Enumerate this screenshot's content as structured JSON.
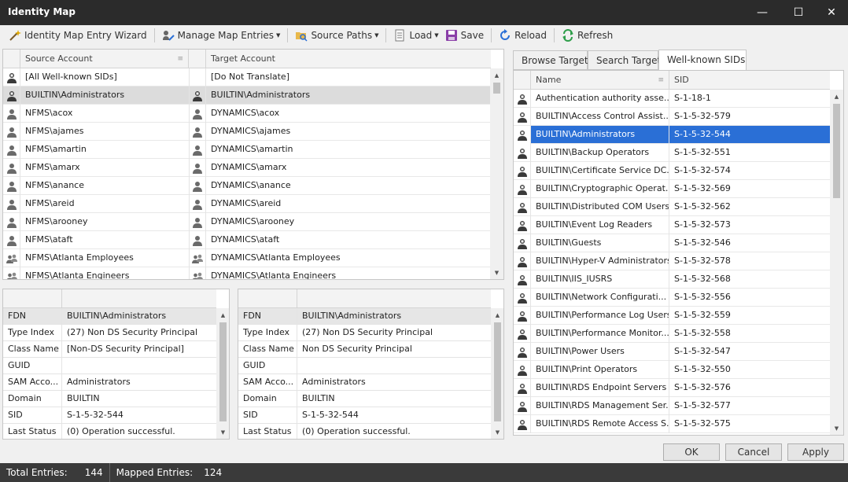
{
  "window": {
    "title": "Identity Map",
    "minimize": "—",
    "maximize": "☐",
    "close": "✕"
  },
  "toolbar": {
    "wizard": "Identity Map Entry Wizard",
    "manage": "Manage Map Entries",
    "source_paths": "Source Paths",
    "load": "Load",
    "save": "Save",
    "reload": "Reload",
    "refresh": "Refresh"
  },
  "map_grid": {
    "headers": {
      "source": "Source Account",
      "target": "Target Account"
    },
    "rows": [
      {
        "source": "[All Well-known SIDs]",
        "target": "[Do Not Translate]",
        "src_icon": "user-shield-icon",
        "tgt_icon": ""
      },
      {
        "source": "BUILTIN\\Administrators",
        "target": "BUILTIN\\Administrators",
        "src_icon": "user-shield-icon",
        "tgt_icon": "user-shield-icon"
      },
      {
        "source": "NFMS\\acox",
        "target": "DYNAMICS\\acox",
        "src_icon": "user-icon",
        "tgt_icon": "user-icon"
      },
      {
        "source": "NFMS\\ajames",
        "target": "DYNAMICS\\ajames",
        "src_icon": "user-icon",
        "tgt_icon": "user-icon"
      },
      {
        "source": "NFMS\\amartin",
        "target": "DYNAMICS\\amartin",
        "src_icon": "user-icon",
        "tgt_icon": "user-icon"
      },
      {
        "source": "NFMS\\amarx",
        "target": "DYNAMICS\\amarx",
        "src_icon": "user-icon",
        "tgt_icon": "user-icon"
      },
      {
        "source": "NFMS\\anance",
        "target": "DYNAMICS\\anance",
        "src_icon": "user-icon",
        "tgt_icon": "user-icon"
      },
      {
        "source": "NFMS\\areid",
        "target": "DYNAMICS\\areid",
        "src_icon": "user-icon",
        "tgt_icon": "user-icon"
      },
      {
        "source": "NFMS\\arooney",
        "target": "DYNAMICS\\arooney",
        "src_icon": "user-icon",
        "tgt_icon": "user-icon"
      },
      {
        "source": "NFMS\\ataft",
        "target": "DYNAMICS\\ataft",
        "src_icon": "user-icon",
        "tgt_icon": "user-icon"
      },
      {
        "source": "NFMS\\Atlanta Employees",
        "target": "DYNAMICS\\Atlanta Employees",
        "src_icon": "group-icon",
        "tgt_icon": "group-icon"
      },
      {
        "source": "NFMS\\Atlanta Engineers",
        "target": "DYNAMICS\\Atlanta Engineers",
        "src_icon": "group-icon",
        "tgt_icon": "group-icon"
      }
    ]
  },
  "source_props": {
    "header_value": "",
    "rows": [
      {
        "label": "FDN",
        "value": "BUILTIN\\Administrators"
      },
      {
        "label": "Type Index",
        "value": "(27) Non DS Security Principal"
      },
      {
        "label": "Class Name",
        "value": "[Non-DS Security Principal]"
      },
      {
        "label": "GUID",
        "value": ""
      },
      {
        "label": "SAM Acco...",
        "value": "Administrators"
      },
      {
        "label": "Domain",
        "value": "BUILTIN"
      },
      {
        "label": "SID",
        "value": "S-1-5-32-544"
      },
      {
        "label": "Last Status",
        "value": "(0) Operation successful."
      }
    ]
  },
  "target_props": {
    "rows": [
      {
        "label": "FDN",
        "value": "BUILTIN\\Administrators"
      },
      {
        "label": "Type Index",
        "value": "(27) Non DS Security Principal"
      },
      {
        "label": "Class Name",
        "value": "Non DS Security Principal"
      },
      {
        "label": "GUID",
        "value": ""
      },
      {
        "label": "SAM Acco...",
        "value": "Administrators"
      },
      {
        "label": "Domain",
        "value": "BUILTIN"
      },
      {
        "label": "SID",
        "value": "S-1-5-32-544"
      },
      {
        "label": "Last Status",
        "value": "(0) Operation successful."
      }
    ]
  },
  "tabs": {
    "browse": "Browse Target",
    "search": "Search Target",
    "wellknown": "Well-known SIDs"
  },
  "sid_grid": {
    "headers": {
      "name": "Name",
      "sid": "SID"
    },
    "rows": [
      {
        "name": "Authentication authority asse...",
        "sid": "S-1-18-1"
      },
      {
        "name": "BUILTIN\\Access Control Assist...",
        "sid": "S-1-5-32-579"
      },
      {
        "name": "BUILTIN\\Administrators",
        "sid": "S-1-5-32-544"
      },
      {
        "name": "BUILTIN\\Backup Operators",
        "sid": "S-1-5-32-551"
      },
      {
        "name": "BUILTIN\\Certificate Service DC...",
        "sid": "S-1-5-32-574"
      },
      {
        "name": "BUILTIN\\Cryptographic Operat...",
        "sid": "S-1-5-32-569"
      },
      {
        "name": "BUILTIN\\Distributed COM Users",
        "sid": "S-1-5-32-562"
      },
      {
        "name": "BUILTIN\\Event Log Readers",
        "sid": "S-1-5-32-573"
      },
      {
        "name": "BUILTIN\\Guests",
        "sid": "S-1-5-32-546"
      },
      {
        "name": "BUILTIN\\Hyper-V Administrators",
        "sid": "S-1-5-32-578"
      },
      {
        "name": "BUILTIN\\IIS_IUSRS",
        "sid": "S-1-5-32-568"
      },
      {
        "name": "BUILTIN\\Network Configurati...",
        "sid": "S-1-5-32-556"
      },
      {
        "name": "BUILTIN\\Performance Log Users",
        "sid": "S-1-5-32-559"
      },
      {
        "name": "BUILTIN\\Performance Monitor...",
        "sid": "S-1-5-32-558"
      },
      {
        "name": "BUILTIN\\Power Users",
        "sid": "S-1-5-32-547"
      },
      {
        "name": "BUILTIN\\Print Operators",
        "sid": "S-1-5-32-550"
      },
      {
        "name": "BUILTIN\\RDS Endpoint Servers",
        "sid": "S-1-5-32-576"
      },
      {
        "name": "BUILTIN\\RDS Management Ser...",
        "sid": "S-1-5-32-577"
      },
      {
        "name": "BUILTIN\\RDS Remote Access S...",
        "sid": "S-1-5-32-575"
      }
    ]
  },
  "buttons": {
    "ok": "OK",
    "cancel": "Cancel",
    "apply": "Apply"
  },
  "status": {
    "total_label": "Total Entries:",
    "total_value": "144",
    "mapped_label": "Mapped Entries:",
    "mapped_value": "124"
  },
  "colors": {
    "selection": "#2a6fd6",
    "titlebar": "#2b2b2b",
    "statusbar": "#3a3a3a"
  }
}
